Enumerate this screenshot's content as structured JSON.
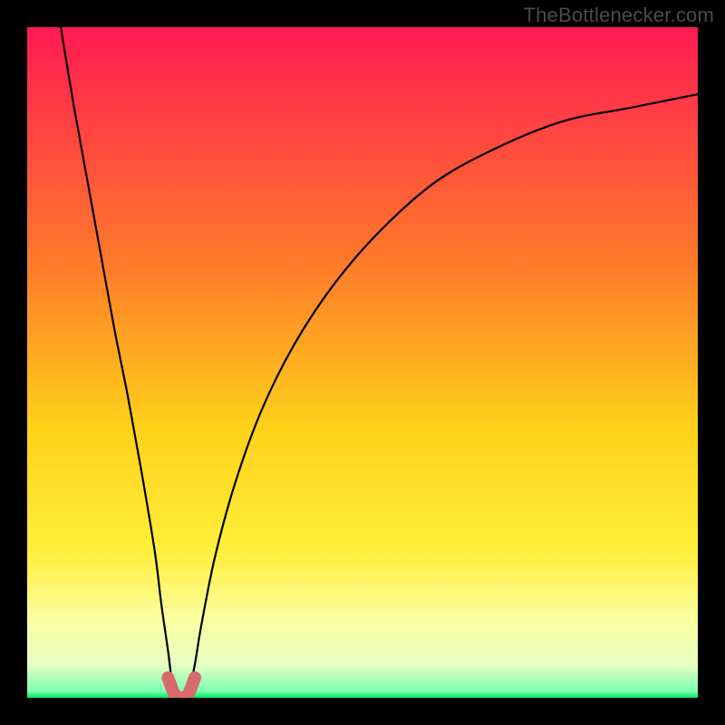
{
  "watermark": "TheBottlenecker.com",
  "colors": {
    "top": "#ff1a53",
    "mid1": "#ff6a2a",
    "mid2": "#ffc31a",
    "mid3": "#ffea2e",
    "pale": "#fdff9a",
    "green": "#00e863",
    "black": "#000000",
    "curve": "#000000",
    "accent": "#d76b6b"
  },
  "chart_data": {
    "type": "line",
    "title": "",
    "xlabel": "",
    "ylabel": "",
    "xlim": [
      0,
      100
    ],
    "ylim": [
      0,
      100
    ],
    "grid": false,
    "legend": false,
    "series": [
      {
        "name": "left-branch",
        "x": [
          5,
          7,
          9,
          11,
          13,
          15,
          17,
          19,
          20,
          21,
          21.5,
          22
        ],
        "y": [
          100,
          88,
          77,
          66,
          55,
          45,
          34,
          22,
          14,
          7,
          3,
          0
        ]
      },
      {
        "name": "right-branch",
        "x": [
          24,
          25,
          26,
          28,
          31,
          35,
          40,
          46,
          53,
          61,
          70,
          80,
          90,
          100
        ],
        "y": [
          0,
          5,
          11,
          21,
          32,
          43,
          53,
          62,
          70,
          77,
          82,
          86,
          88,
          90
        ]
      },
      {
        "name": "bottom-accent",
        "x": [
          21,
          22,
          23,
          24,
          25
        ],
        "y": [
          3,
          0.5,
          0,
          0.5,
          3
        ]
      }
    ],
    "gradient_stops": [
      {
        "pct": 0,
        "color": "#ff1a53"
      },
      {
        "pct": 35,
        "color": "#ff7a2a"
      },
      {
        "pct": 60,
        "color": "#ffd21a"
      },
      {
        "pct": 78,
        "color": "#ffee3a"
      },
      {
        "pct": 88,
        "color": "#fcff9e"
      },
      {
        "pct": 95,
        "color": "#e8ffc2"
      },
      {
        "pct": 99,
        "color": "#7dffb0"
      },
      {
        "pct": 100,
        "color": "#00e863"
      }
    ]
  }
}
